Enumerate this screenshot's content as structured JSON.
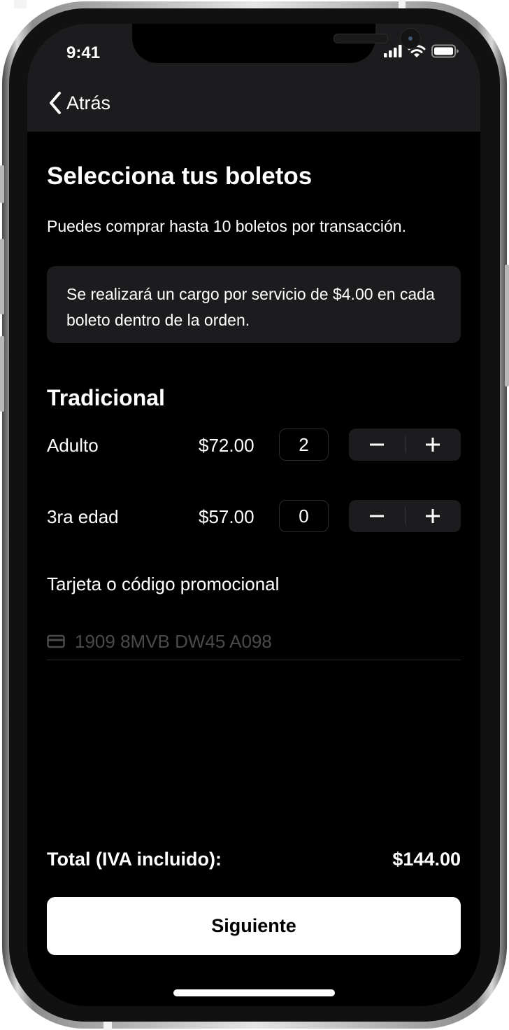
{
  "status_bar": {
    "time": "9:41"
  },
  "nav": {
    "back_label": "Atrás"
  },
  "page": {
    "title": "Selecciona tus boletos",
    "subtitle": "Puedes comprar hasta 10 boletos por transacción.",
    "notice": "Se realizará un cargo por servicio de $4.00 en cada boleto dentro de la orden."
  },
  "section": {
    "title": "Tradicional"
  },
  "tickets": [
    {
      "name": "Adulto",
      "price": "$72.00",
      "qty": "2"
    },
    {
      "name": "3ra edad",
      "price": "$57.00",
      "qty": "0"
    }
  ],
  "stepper": {
    "minus": "−",
    "plus": "+"
  },
  "promo": {
    "label": "Tarjeta o código promocional",
    "placeholder": "1909 8MVB DW45 A098",
    "value": ""
  },
  "total": {
    "label": "Total (IVA incluido):",
    "value": "$144.00"
  },
  "next_button": {
    "label": "Siguiente"
  },
  "colors": {
    "background": "#000000",
    "surface": "#1c1c1e",
    "text": "#ffffff",
    "placeholder": "#4a4a4c",
    "button_bg": "#ffffff",
    "button_text": "#000000"
  },
  "icons": {
    "back": "chevron-left-icon",
    "signal": "cellular-signal-icon",
    "wifi": "wifi-icon",
    "battery": "battery-icon",
    "card": "credit-card-icon"
  }
}
